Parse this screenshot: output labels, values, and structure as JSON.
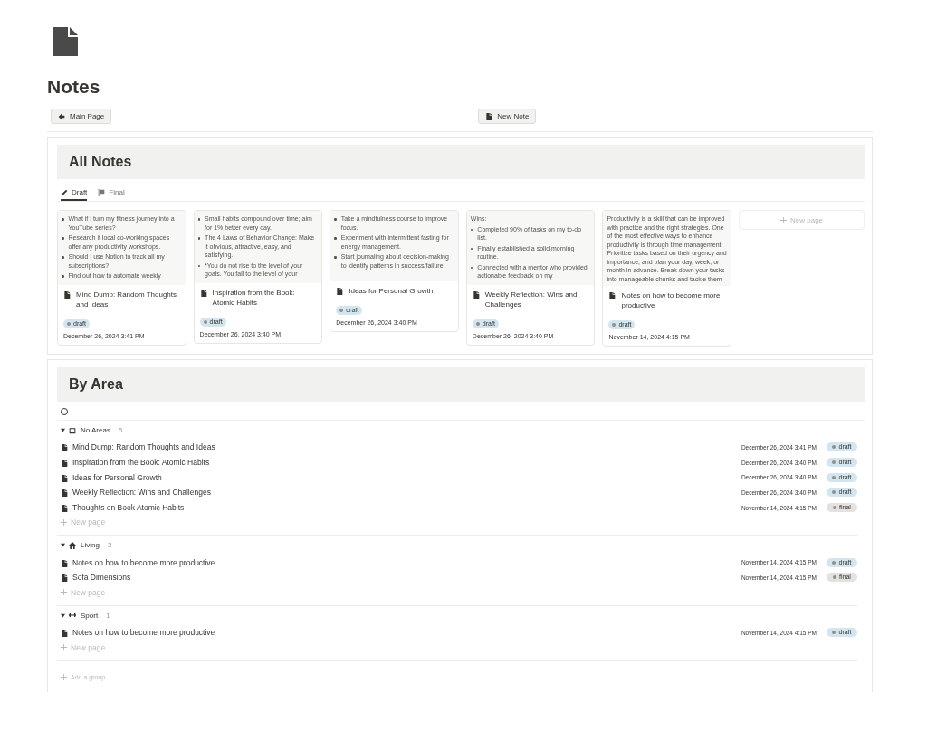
{
  "page": {
    "title": "Notes"
  },
  "buttons": [
    {
      "label": "Main Page",
      "kind": "back"
    },
    {
      "label": "New Note",
      "kind": "page"
    }
  ],
  "all_notes": {
    "title": "All Notes",
    "tabs": [
      {
        "label": "Draft",
        "selected": true,
        "kind": "pencil"
      },
      {
        "label": "Final",
        "selected": false,
        "kind": "flag"
      }
    ],
    "cards": [
      {
        "preview": [
          "What if I turn my fitness journey into a YouTube series?",
          "Research if local co-working spaces offer any productivity workshops.",
          "Should I use Notion to track all my subscriptions?",
          "Find out how to automate weekly"
        ],
        "title": "Mind Dump: Random Thoughts and Ideas",
        "tag": {
          "label": "draft",
          "color": "#d3e5ef"
        },
        "date": "December 26, 2024 3:41 PM"
      },
      {
        "preview": [
          "Small habits compound over time; aim for 1% better every day.",
          "The 4 Laws of Behavior Change: Make it obvious, attractive, easy, and satisfying.",
          "*You do not rise to the level of your goals. You fall to the level of your"
        ],
        "title": "Inspiration from the Book: Atomic Habits",
        "tag": {
          "label": "draft",
          "color": "#d3e5ef"
        },
        "date": "December 26, 2024 3:40 PM"
      },
      {
        "preview": [
          "Take a mindfulness course to improve focus.",
          "Experiment with intermittent fasting for energy management.",
          "Start journaling about decision-making to identify patterns in success/failure."
        ],
        "title": "Ideas for Personal Growth",
        "tag": {
          "label": "draft",
          "color": "#d3e5ef"
        },
        "date": "December 26, 2024 3:40 PM"
      },
      {
        "preview_heading": "Wins:",
        "preview": [
          "Completed 90% of tasks on my to-do list.",
          "Finally established a solid morning routine.",
          "Connected with a mentor who provided actionable feedback on my"
        ],
        "title": "Weekly Reflection: Wins and Challenges",
        "tag": {
          "label": "draft",
          "color": "#d3e5ef"
        },
        "date": "December 26, 2024 3:40 PM"
      },
      {
        "preview_text": [
          "Productivity is a skill that can be improved with practice and the right strategies. One of the most effective ways to enhance productivity is through time management. Prioritize tasks based on their urgency and importance, and plan your day, week, or month in advance. Break down your tasks into manageable chunks and tackle them"
        ],
        "title": "Notes on how to become more productive",
        "tag": {
          "label": "draft",
          "color": "#d3e5ef"
        },
        "date": "November 14, 2024 4:15 PM"
      }
    ],
    "new_page": "New page"
  },
  "by_area": {
    "title": "By Area",
    "groups": [
      {
        "name": "No Areas",
        "kind": "inbox",
        "count": "5",
        "expanded": true,
        "rows": [
          {
            "title": "Mind Dump: Random Thoughts and Ideas",
            "date": "December 26, 2024 3:41 PM",
            "tag": {
              "label": "draft",
              "color": "#d3e5ef"
            }
          },
          {
            "title": "Inspiration from the Book: Atomic Habits",
            "date": "December 26, 2024 3:40 PM",
            "tag": {
              "label": "draft",
              "color": "#d3e5ef"
            }
          },
          {
            "title": "Ideas for Personal Growth",
            "date": "December 26, 2024 3:40 PM",
            "tag": {
              "label": "draft",
              "color": "#d3e5ef"
            }
          },
          {
            "title": "Weekly Reflection: Wins and Challenges",
            "date": "December 26, 2024 3:40 PM",
            "tag": {
              "label": "draft",
              "color": "#d3e5ef"
            }
          },
          {
            "title": "Thoughts on Book Atomic Habits",
            "date": "November 14, 2024 4:15 PM",
            "tag": {
              "label": "final",
              "color": "#e3e2e0"
            }
          }
        ],
        "new_page": "New page"
      },
      {
        "name": "Living",
        "kind": "home",
        "count": "2",
        "expanded": true,
        "rows": [
          {
            "title": "Notes on how to become more productive",
            "date": "November 14, 2024 4:15 PM",
            "tag": {
              "label": "draft",
              "color": "#d3e5ef"
            }
          },
          {
            "title": "Sofa Dimensions",
            "date": "November 14, 2024 4:15 PM",
            "tag": {
              "label": "final",
              "color": "#e3e2e0"
            }
          }
        ],
        "new_page": "New page"
      },
      {
        "name": "Sport",
        "kind": "dumbbell",
        "count": "1",
        "expanded": true,
        "rows": [
          {
            "title": "Notes on how to become more productive",
            "date": "November 14, 2024 4:15 PM",
            "tag": {
              "label": "draft",
              "color": "#d3e5ef"
            }
          }
        ],
        "new_page": "New page"
      }
    ],
    "add_group": "Add a group"
  }
}
